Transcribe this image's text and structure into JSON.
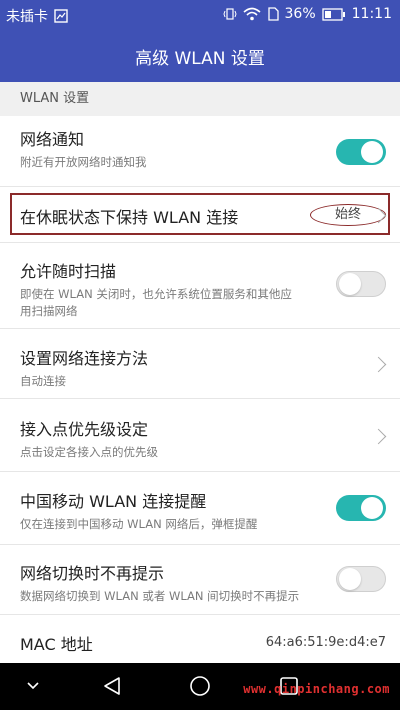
{
  "status_bar": {
    "carrier": "未插卡",
    "battery": "36%",
    "time": "11:11"
  },
  "app_bar": {
    "title": "高级 WLAN 设置"
  },
  "section_header": "WLAN 设置",
  "settings": {
    "network_notify": {
      "title": "网络通知",
      "subtitle": "附近有开放网络时通知我",
      "enabled": true
    },
    "keep_wlan_sleep": {
      "title": "在休眠状态下保持 WLAN 连接",
      "value": "始终"
    },
    "always_scan": {
      "title": "允许随时扫描",
      "subtitle_line1": "即使在 WLAN 关闭时，也允许系统位置服务和其他应",
      "subtitle_line2": "用扫描网络",
      "enabled": false
    },
    "connection_method": {
      "title": "设置网络连接方法",
      "subtitle": "自动连接"
    },
    "ap_priority": {
      "title": "接入点优先级设定",
      "subtitle": "点击设定各接入点的优先级"
    },
    "cmcc_remind": {
      "title": "中国移动 WLAN 连接提醒",
      "subtitle": "仅在连接到中国移动 WLAN 网络后，弹框提醒",
      "enabled": true
    },
    "no_switch_prompt": {
      "title": "网络切换时不再提示",
      "subtitle": "数据网络切换到 WLAN 或者 WLAN 间切换时不再提示",
      "enabled": false
    },
    "mac": {
      "title": "MAC 地址",
      "value": "64:a6:51:9e:d4:e7"
    }
  },
  "watermark": "www.qinpinchang.com",
  "colors": {
    "header": "#3f51b5",
    "accent": "#27b6b0",
    "annotation": "#8b2a2a"
  }
}
